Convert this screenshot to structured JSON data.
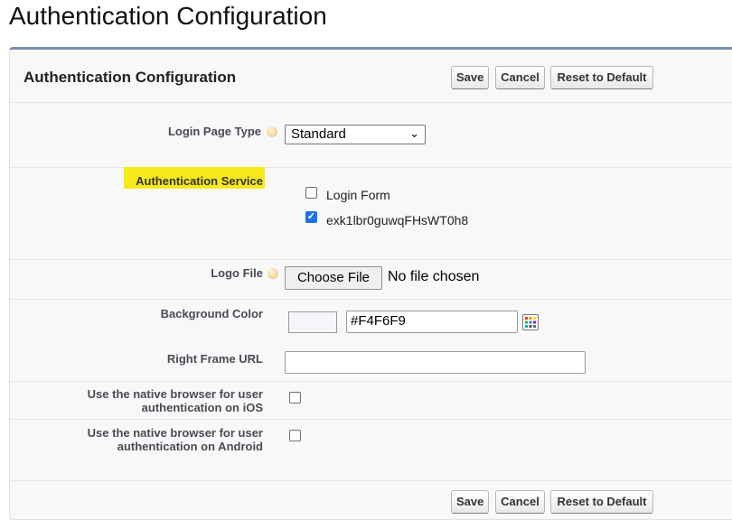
{
  "page": {
    "title": "Authentication Configuration"
  },
  "panel": {
    "title": "Authentication Configuration"
  },
  "buttons": {
    "save": "Save",
    "cancel": "Cancel",
    "reset": "Reset to Default"
  },
  "fields": {
    "login_page_type": {
      "label": "Login Page Type",
      "value": "Standard"
    },
    "authentication_service": {
      "label": "Authentication Service",
      "options": [
        {
          "label": "Login Form",
          "checked": false
        },
        {
          "label": "exk1lbr0guwqFHsWT0h8",
          "checked": true
        }
      ]
    },
    "logo_file": {
      "label": "Logo File",
      "button": "Choose File",
      "status": "No file chosen"
    },
    "background_color": {
      "label": "Background Color",
      "value": "#F4F6F9",
      "swatch_color": "#f4f6f9"
    },
    "right_frame_url": {
      "label": "Right Frame URL",
      "value": ""
    },
    "native_ios": {
      "label_line1": "Use the native browser for user",
      "label_line2": "authentication on iOS",
      "checked": false
    },
    "native_android": {
      "label_line1": "Use the native browser for user",
      "label_line2": "authentication on Android",
      "checked": false
    }
  },
  "icons": {
    "help": "help-icon",
    "palette": "color-palette-icon",
    "dropdown": "chevron-down-icon"
  },
  "colors": {
    "highlight": "#f6ea1b",
    "panel_border": "#7a8ea6",
    "checkbox_checked": "#1a73e8"
  }
}
